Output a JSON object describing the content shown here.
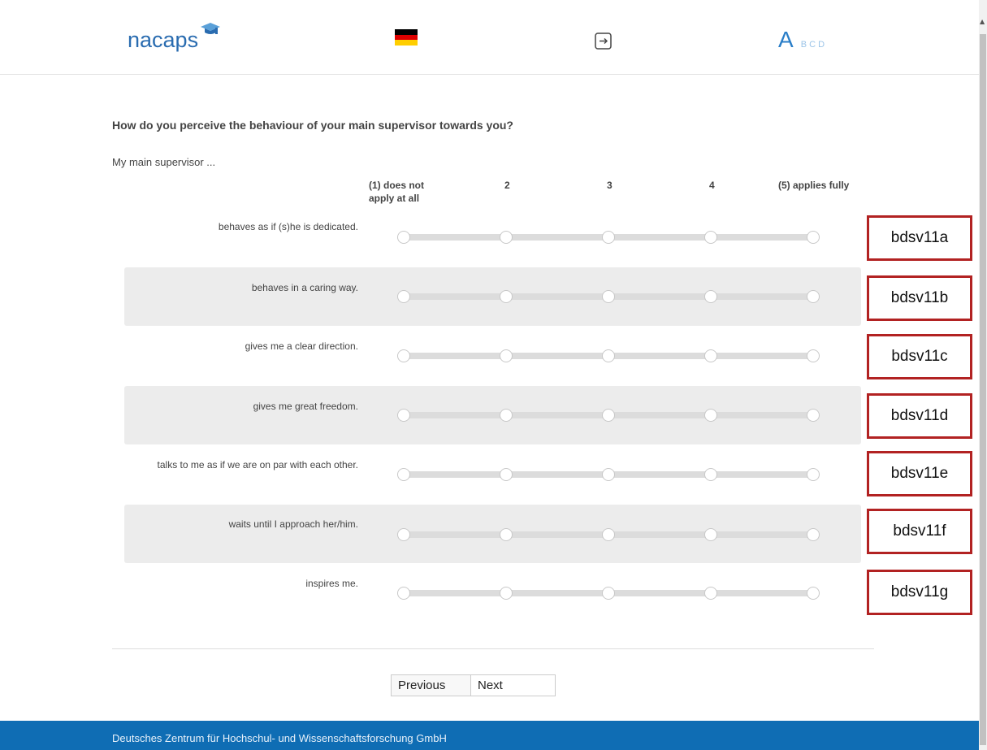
{
  "header": {
    "logo_text": "nacaps",
    "language_flag": "flag-germany",
    "logout_icon": "logout-icon",
    "font_size": {
      "large": "A",
      "options": "B C D"
    }
  },
  "question": {
    "title": "How do you perceive the behaviour of your main supervisor towards you?",
    "intro": "My main supervisor ...",
    "scale": [
      "(1) does not apply at all",
      "2",
      "3",
      "4",
      "(5) applies fully"
    ],
    "scale_col1_line1": "(1) does not",
    "scale_col1_line2": "apply at all",
    "items": [
      {
        "label": "behaves as if (s)he is dedicated.",
        "variable": "bdsv11a"
      },
      {
        "label": "behaves in a caring way.",
        "variable": "bdsv11b"
      },
      {
        "label": "gives me a clear direction.",
        "variable": "bdsv11c"
      },
      {
        "label": "gives me great freedom.",
        "variable": "bdsv11d"
      },
      {
        "label": "talks to me as if we are on par with each other.",
        "variable": "bdsv11e"
      },
      {
        "label": "waits until I approach her/him.",
        "variable": "bdsv11f"
      },
      {
        "label": "inspires me.",
        "variable": "bdsv11g"
      }
    ]
  },
  "navigation": {
    "previous": "Previous",
    "next": "Next"
  },
  "footer": {
    "text": "Deutsches Zentrum für Hochschul- und Wissenschaftsforschung GmbH"
  },
  "colors": {
    "brand": "#2a6cb0",
    "footer": "#0f6db4",
    "annotation": "#b22222"
  }
}
